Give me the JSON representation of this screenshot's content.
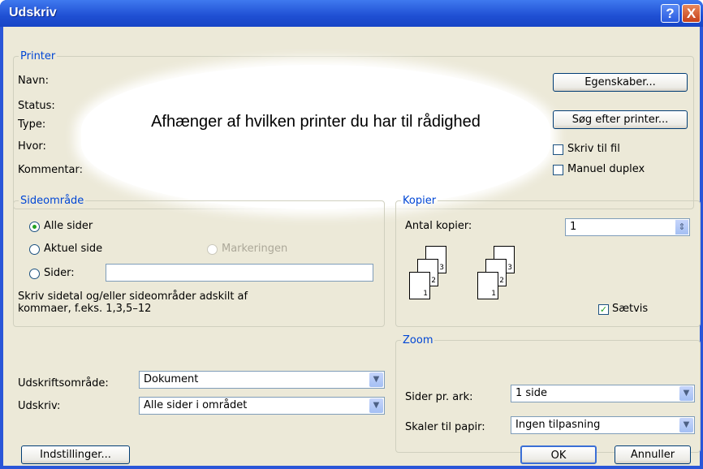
{
  "window": {
    "title": "Udskriv",
    "help_symbol": "?",
    "close_symbol": "X"
  },
  "printer": {
    "legend": "Printer",
    "labels": {
      "name": "Navn:",
      "status": "Status:",
      "type": "Type:",
      "where": "Hvor:",
      "comment": "Kommentar:"
    },
    "overlay_text": "Afhænger af hvilken printer du har til rådighed",
    "properties_button": "Egenskaber...",
    "find_button": "Søg efter printer...",
    "print_to_file": {
      "label": "Skriv til fil",
      "checked": false
    },
    "manual_duplex": {
      "label": "Manuel duplex",
      "checked": false
    }
  },
  "page_range": {
    "legend": "Sideområde",
    "all": {
      "label": "Alle sider",
      "selected": true
    },
    "current": {
      "label": "Aktuel side",
      "selected": false
    },
    "selection": {
      "label": "Markeringen",
      "enabled": false
    },
    "pages": {
      "label": "Sider:",
      "value": ""
    },
    "hint": "Skriv sidetal og/eller sideområder adskilt af kommaer, f.eks. 1,3,5–12"
  },
  "copies": {
    "legend": "Kopier",
    "count_label": "Antal kopier:",
    "count_value": "1",
    "spin_symbol": "⇕",
    "collate": {
      "label": "Sætvis",
      "checked": true
    },
    "page_numbers": [
      "1",
      "2",
      "3"
    ]
  },
  "print_what": {
    "label": "Udskriftsområde:",
    "value": "Dokument"
  },
  "print": {
    "label": "Udskriv:",
    "value": "Alle sider i området"
  },
  "zoom": {
    "legend": "Zoom",
    "pages_per_sheet": {
      "label": "Sider pr. ark:",
      "value": "1 side"
    },
    "scale": {
      "label": "Skaler til papir:",
      "value": "Ingen tilpasning"
    }
  },
  "footer": {
    "options_button": "Indstillinger...",
    "ok_button": "OK",
    "cancel_button": "Annuller"
  },
  "dropdown_arrow": "▼",
  "checkmark": "✓",
  "colors": {
    "title_bar": "#2a56d8",
    "dialog_bg": "#ece9d8",
    "group_label": "#0046d5",
    "radio_dot": "#21a121"
  }
}
